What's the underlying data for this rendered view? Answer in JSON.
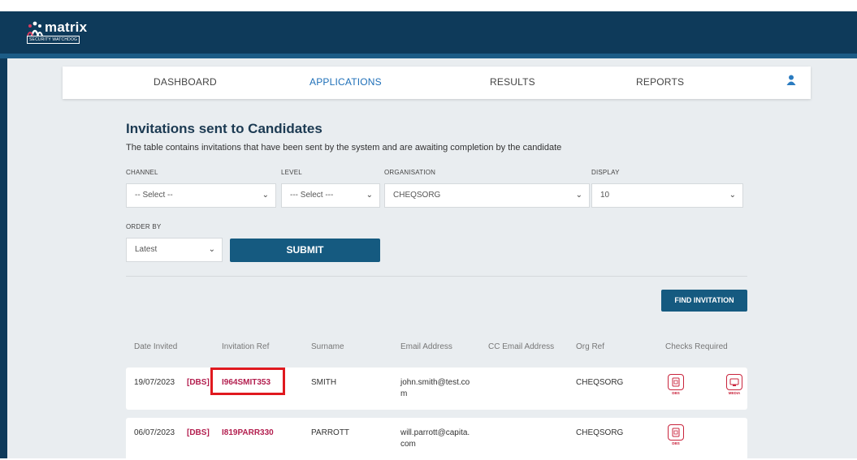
{
  "brand": {
    "name": "matrix",
    "tagline": "SECURITY WATCHDOG"
  },
  "nav": {
    "items": [
      "DASHBOARD",
      "APPLICATIONS",
      "RESULTS",
      "REPORTS"
    ],
    "active": "APPLICATIONS"
  },
  "page": {
    "title": "Invitations sent to Candidates",
    "description": "The table contains invitations that have been sent by the system and are awaiting completion by the candidate"
  },
  "filters": {
    "channel": {
      "label": "CHANNEL",
      "value": "-- Select --"
    },
    "level": {
      "label": "LEVEL",
      "value": "--- Select ---"
    },
    "organisation": {
      "label": "ORGANISATION",
      "value": "CHEQSORG"
    },
    "display": {
      "label": "DISPLAY",
      "value": "10"
    },
    "order_by": {
      "label": "ORDER BY",
      "value": "Latest"
    },
    "submit_label": "SUBMIT"
  },
  "find_invitation_label": "FIND INVITATION",
  "table": {
    "columns": [
      "Date Invited",
      "Invitation Ref",
      "Surname",
      "Email Address",
      "CC Email Address",
      "Org Ref",
      "Checks Required"
    ],
    "rows": [
      {
        "date": "19/07/2023",
        "type": "[DBS]",
        "ref": "I964SMIT353",
        "surname": "SMITH",
        "email_line1": "john.smith@test.co",
        "email_line2": "m",
        "cc": "",
        "org": "CHEQSORG",
        "checks": [
          "DBS",
          "MEDIA"
        ]
      },
      {
        "date": "06/07/2023",
        "type": "[DBS]",
        "ref": "I819PARR330",
        "surname": "PARROTT",
        "email_line1": "will.parrott@capita.",
        "email_line2": "com",
        "cc": "",
        "org": "CHEQSORG",
        "checks": [
          "DBS"
        ]
      }
    ]
  },
  "colors": {
    "header": "#0e3a5a",
    "accent": "#1e6fb8",
    "button": "#155a80",
    "ref": "#b31f4f",
    "highlight": "#e0191f"
  }
}
